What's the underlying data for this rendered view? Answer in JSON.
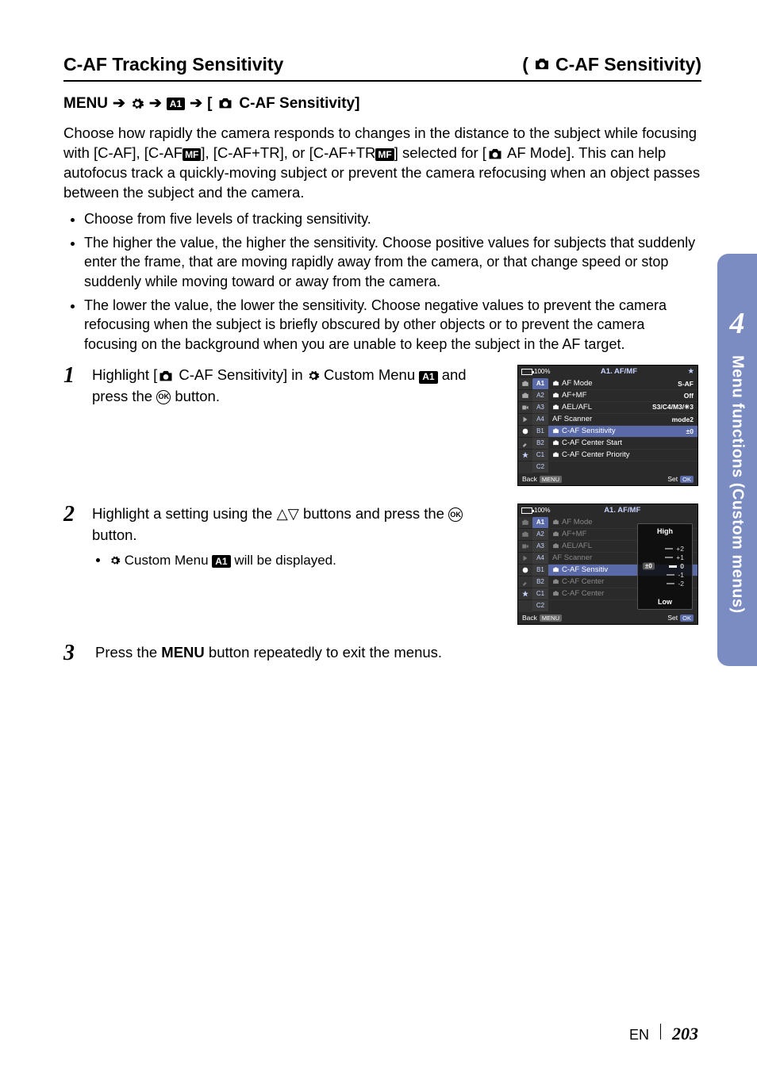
{
  "sideTab": {
    "chapter": "4",
    "label": "Menu functions (Custom menus)"
  },
  "title": {
    "left": "C-AF Tracking Sensitivity",
    "rightPrefix": "(",
    "rightText": "C-AF Sensitivity)",
    "rightSuffix": ""
  },
  "menuPath": {
    "menuWord": "MENU",
    "a1": "A1",
    "settingLabel": "C-AF Sensitivity]"
  },
  "intro": {
    "p1a": "Choose how rapidly the camera responds to changes in the distance to the subject while focusing with [C-AF], [C-AF",
    "mf1": "MF",
    "p1b": "], [C-AF+TR], or [C-AF+TR",
    "mf2": "MF",
    "p1c": "] selected for [",
    "p1d": " AF Mode]. This can help autofocus track a quickly-moving subject or prevent the camera refocusing when an object passes between the subject and the camera."
  },
  "bullets": [
    "Choose from five levels of tracking sensitivity.",
    "The higher the value, the higher the sensitivity. Choose positive values for subjects that suddenly enter the frame, that are moving rapidly away from the camera, or that change speed or stop suddenly while moving toward or away from the camera.",
    "The lower the value, the lower the sensitivity. Choose negative values to prevent the camera refocusing when the subject is briefly obscured by other objects or to prevent the camera focusing on the background when you are unable to keep the subject in the AF target."
  ],
  "steps": {
    "s1": {
      "num": "1",
      "a": "Highlight [",
      "b": " C-AF Sensitivity] in ",
      "c": " Custom Menu ",
      "a1": "A1",
      "d": " and press the ",
      "e": " button."
    },
    "s2": {
      "num": "2",
      "a": "Highlight a setting using the ",
      "b": " buttons and press the ",
      "c": " button.",
      "sub_a": " Custom Menu ",
      "sub_a1": "A1",
      "sub_b": " will be displayed."
    },
    "s3": {
      "num": "3",
      "a": "Press the ",
      "menu": "MENU",
      "b": " button repeatedly to exit the menus."
    }
  },
  "screenshot1": {
    "battery": "100%",
    "title": "A1. AF/MF",
    "tabs": [
      "A1",
      "A2",
      "A3",
      "A4",
      "B1",
      "B2",
      "C1",
      "C2"
    ],
    "rows": [
      {
        "icon": true,
        "label": "AF Mode",
        "value": "S-AF"
      },
      {
        "icon": true,
        "label": "AF+MF",
        "value": "Off"
      },
      {
        "icon": true,
        "label": "AEL/AFL",
        "value": "S3/C4/M3/✳3"
      },
      {
        "icon": false,
        "label": "AF Scanner",
        "value": "mode2"
      },
      {
        "icon": true,
        "label": "C-AF Sensitivity",
        "value": "±0",
        "highlight": true
      },
      {
        "icon": true,
        "label": "C-AF Center Start",
        "value": ""
      },
      {
        "icon": true,
        "label": "C-AF Center Priority",
        "value": ""
      }
    ],
    "footer": {
      "backLabel": "Back",
      "backBadge": "MENU",
      "setLabel": "Set",
      "setBadge": "OK"
    }
  },
  "screenshot2": {
    "battery": "100%",
    "title": "A1. AF/MF",
    "tabs": [
      "A1",
      "A2",
      "A3",
      "A4",
      "B1",
      "B2",
      "C1",
      "C2"
    ],
    "rows": [
      {
        "icon": true,
        "label": "AF Mode"
      },
      {
        "icon": true,
        "label": "AF+MF"
      },
      {
        "icon": true,
        "label": "AEL/AFL"
      },
      {
        "icon": false,
        "label": "AF Scanner"
      },
      {
        "icon": true,
        "label": "C-AF Sensitiv",
        "highlight": true
      },
      {
        "icon": true,
        "label": "C-AF Center"
      },
      {
        "icon": true,
        "label": "C-AF Center"
      }
    ],
    "popup": {
      "topLabel": "High",
      "options": [
        "+2",
        "+1",
        "0",
        "-1",
        "-2"
      ],
      "selectedIndex": 2,
      "selectedBadge": "±0",
      "bottomLabel": "Low"
    },
    "footer": {
      "backLabel": "Back",
      "backBadge": "MENU",
      "setLabel": "Set",
      "setBadge": "OK"
    }
  },
  "footer": {
    "lang": "EN",
    "page": "203"
  }
}
